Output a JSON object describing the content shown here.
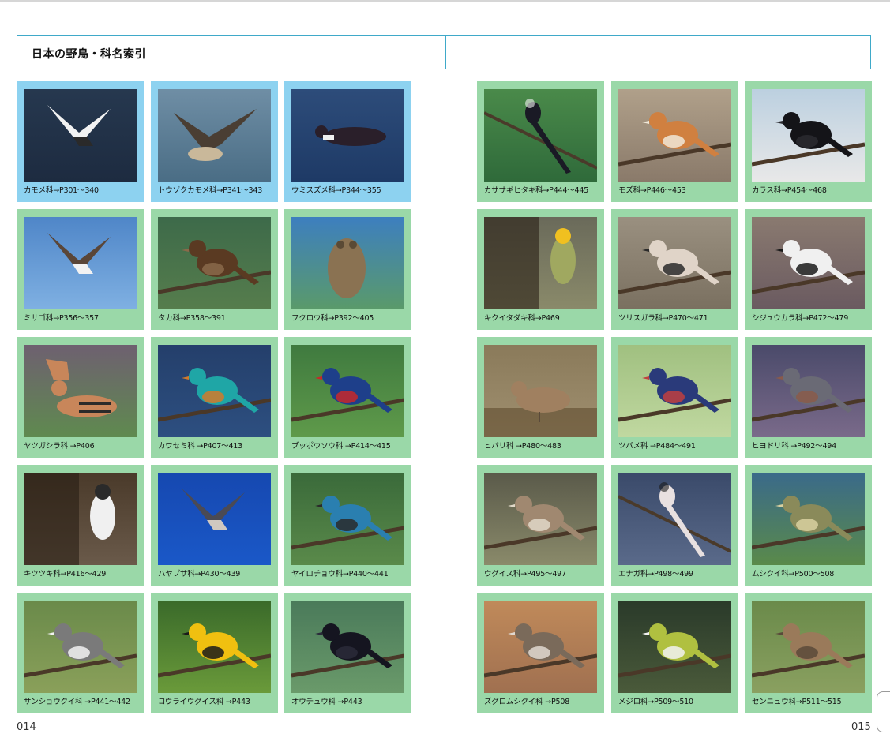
{
  "header": {
    "title": "日本の野鳥・科名索引"
  },
  "pages": {
    "left": "014",
    "right": "015"
  },
  "left_cards": [
    {
      "caption": "カモメ科→P301〜340",
      "color": "blue",
      "scene": "seagull"
    },
    {
      "caption": "トウゾクカモメ科→P341〜343",
      "color": "blue",
      "scene": "skua"
    },
    {
      "caption": "ウミスズメ科→P344〜355",
      "color": "blue",
      "scene": "murrelet"
    },
    {
      "caption": "ミサゴ科→P356〜357",
      "color": "green",
      "scene": "osprey"
    },
    {
      "caption": "タカ科→P358〜391",
      "color": "green",
      "scene": "kite"
    },
    {
      "caption": "フクロウ科→P392〜405",
      "color": "green",
      "scene": "owl"
    },
    {
      "caption": "ヤツガシラ科 →P406",
      "color": "green",
      "scene": "hoopoe"
    },
    {
      "caption": "カワセミ科 →P407〜413",
      "color": "green",
      "scene": "kingfisher"
    },
    {
      "caption": "ブッポウソウ科 →P414〜415",
      "color": "green",
      "scene": "roller"
    },
    {
      "caption": "キツツキ科→P416〜429",
      "color": "green",
      "scene": "woodpecker"
    },
    {
      "caption": "ハヤブサ科→P430〜439",
      "color": "green",
      "scene": "falcon"
    },
    {
      "caption": "ヤイロチョウ科→P440〜441",
      "color": "green",
      "scene": "pitta"
    },
    {
      "caption": "サンショウクイ科 →P441〜442",
      "color": "green",
      "scene": "minivet"
    },
    {
      "caption": "コウライウグイス科 →P443",
      "color": "green",
      "scene": "oriole"
    },
    {
      "caption": "オウチュウ科 →P443",
      "color": "green",
      "scene": "drongo"
    }
  ],
  "right_cards": [
    {
      "caption": "カササギヒタキ科→P444〜445",
      "color": "green",
      "scene": "flycatcher"
    },
    {
      "caption": "モズ科→P446〜453",
      "color": "green",
      "scene": "shrike"
    },
    {
      "caption": "カラス科→P454〜468",
      "color": "green",
      "scene": "crow"
    },
    {
      "caption": "キクイタダキ科→P469",
      "color": "green",
      "scene": "goldcrest"
    },
    {
      "caption": "ツリスガラ科→P470〜471",
      "color": "green",
      "scene": "penduline"
    },
    {
      "caption": "シジュウカラ科→P472〜479",
      "color": "green",
      "scene": "tit"
    },
    {
      "caption": "ヒバリ科 →P480〜483",
      "color": "green",
      "scene": "lark"
    },
    {
      "caption": "ツバメ科 →P484〜491",
      "color": "green",
      "scene": "swallow"
    },
    {
      "caption": "ヒヨドリ科 →P492〜494",
      "color": "green",
      "scene": "bulbul"
    },
    {
      "caption": "ウグイス科→P495〜497",
      "color": "green",
      "scene": "bushwarbler"
    },
    {
      "caption": "エナガ科→P498〜499",
      "color": "green",
      "scene": "longtailedtit"
    },
    {
      "caption": "ムシクイ科→P500〜508",
      "color": "green",
      "scene": "leafwarbler"
    },
    {
      "caption": "ズグロムシクイ科 →P508",
      "color": "green",
      "scene": "blackcap"
    },
    {
      "caption": "メジロ科→P509〜510",
      "color": "green",
      "scene": "whiteeye"
    },
    {
      "caption": "センニュウ科→P511〜515",
      "color": "green",
      "scene": "grasshopperwarbler"
    }
  ]
}
